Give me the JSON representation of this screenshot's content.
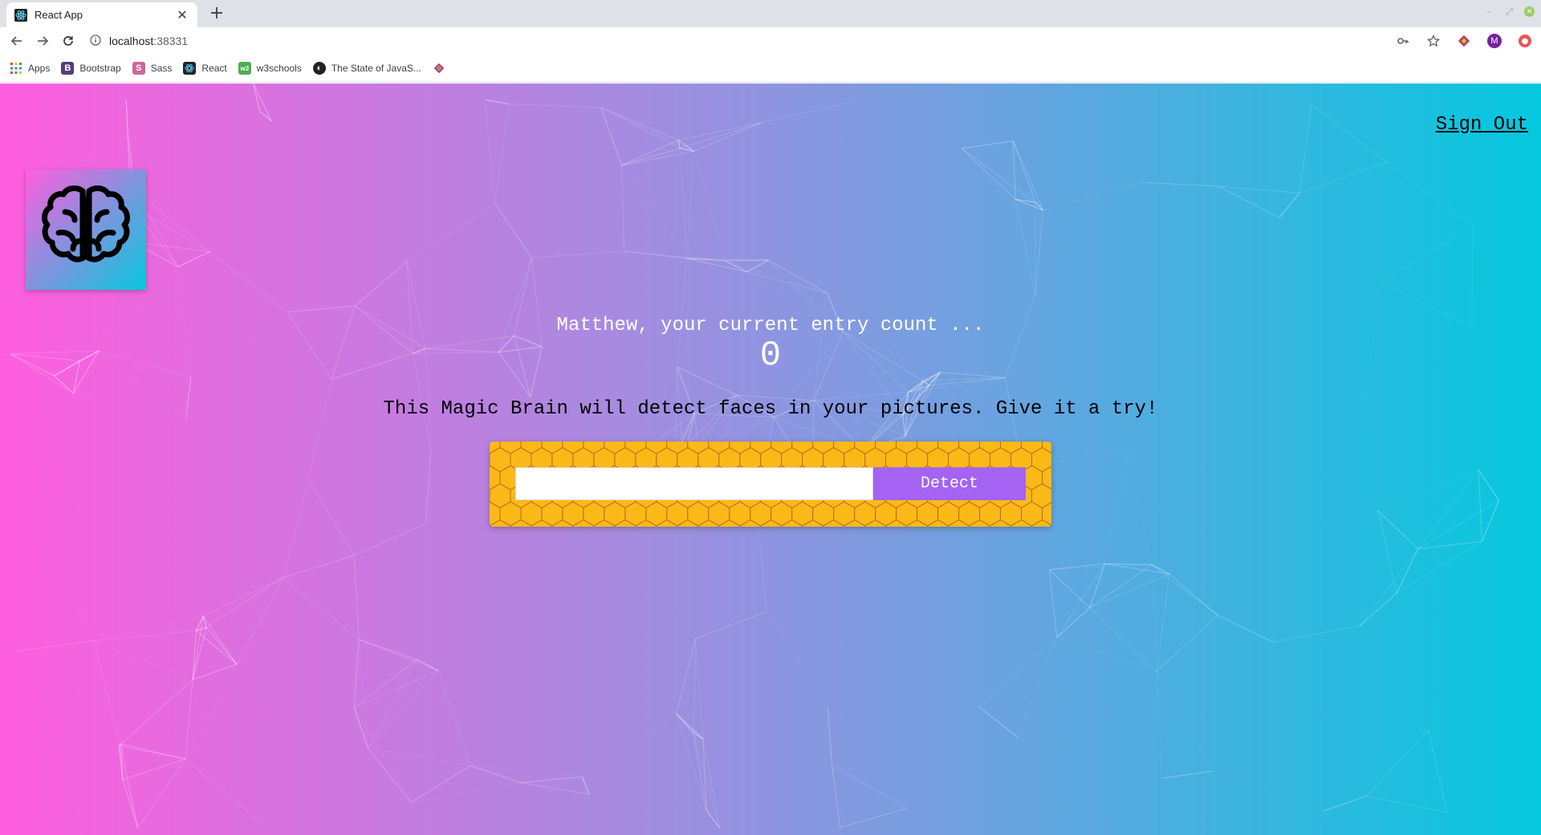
{
  "browser": {
    "tab_title": "React App",
    "new_tab_symbol": "+",
    "url_host": "localhost",
    "url_port": ":38331",
    "profile_initial": "M",
    "bookmarks": [
      {
        "label": "Apps",
        "icon": "apps-grid-icon"
      },
      {
        "label": "Bootstrap",
        "icon": "bootstrap-icon"
      },
      {
        "label": "Sass",
        "icon": "sass-icon"
      },
      {
        "label": "React",
        "icon": "react-icon"
      },
      {
        "label": "w3schools",
        "icon": "w3schools-icon"
      },
      {
        "label": "The State of JavaS...",
        "icon": "state-of-js-icon"
      },
      {
        "label": "",
        "icon": "colorful-extension-icon"
      }
    ]
  },
  "page": {
    "signout_label": "Sign Out",
    "rank_text": "Matthew, your current entry count ...",
    "rank_count": "0",
    "intro_text": "This Magic Brain will detect faces in your pictures. Give it a try!",
    "input_value": "",
    "detect_label": "Detect"
  },
  "colors": {
    "gradient_left": "#ff5edf",
    "gradient_right": "#04c8de",
    "panel_bg": "#fbb917",
    "button_bg": "#a463f2"
  }
}
